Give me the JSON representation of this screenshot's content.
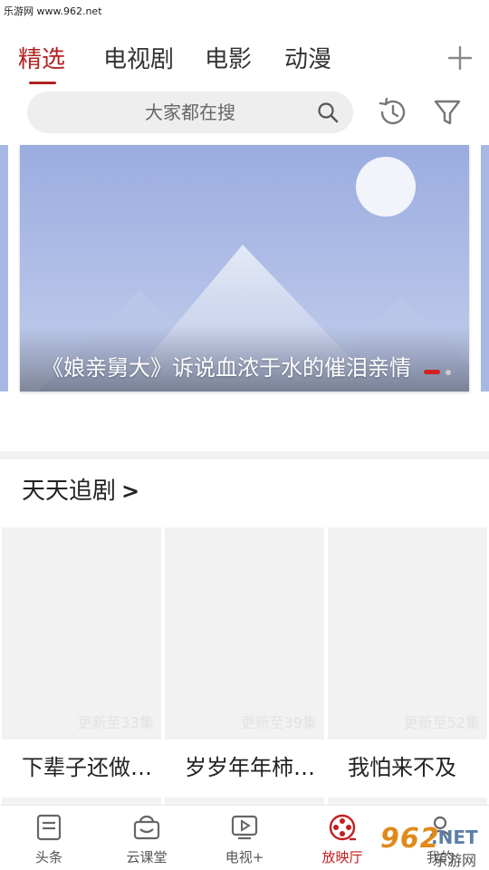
{
  "watermark": {
    "site": "乐游网 www.962.net",
    "logo_number": "962",
    "logo_suffix": ".NET",
    "logo_cn": "乐游网"
  },
  "tabs": [
    {
      "label": "精选",
      "active": true
    },
    {
      "label": "电视剧",
      "active": false
    },
    {
      "label": "电影",
      "active": false
    },
    {
      "label": "动漫",
      "active": false
    }
  ],
  "header_icons": {
    "add": "plus-icon",
    "history": "history-icon",
    "filter": "filter-icon"
  },
  "search": {
    "placeholder": "大家都在搜",
    "icon": "search-icon"
  },
  "banner": {
    "caption": "《娘亲舅大》诉说血浓于水的催泪亲情",
    "dots": 2,
    "active_dot": 0
  },
  "section": {
    "title": "天天追剧",
    "more": ">"
  },
  "cards": [
    {
      "badge": "更新至33集",
      "title": "下辈子还做…"
    },
    {
      "badge": "更新至39集",
      "title": "岁岁年年柿…"
    },
    {
      "badge": "更新至52集",
      "title": "我怕来不及"
    }
  ],
  "bottom_nav": [
    {
      "label": "头条",
      "icon": "news-icon",
      "active": false
    },
    {
      "label": "云课堂",
      "icon": "classroom-icon",
      "active": false
    },
    {
      "label": "电视+",
      "icon": "tv-icon",
      "active": false
    },
    {
      "label": "放映厅",
      "icon": "film-reel-icon",
      "active": true
    },
    {
      "label": "我的",
      "icon": "user-icon",
      "active": false
    }
  ],
  "colors": {
    "accent": "#b22222",
    "active_nav": "#c41e1e",
    "banner_sky": "#a8b8e4",
    "card_bg": "#f2f2f2"
  }
}
